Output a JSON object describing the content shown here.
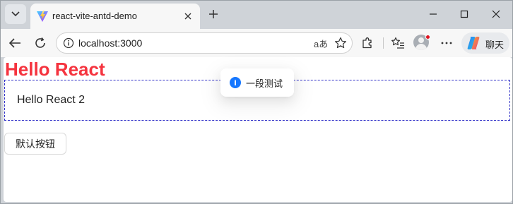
{
  "browser": {
    "tab": {
      "title": "react-vite-antd-demo"
    },
    "window_controls": [
      "minimize",
      "maximize",
      "close"
    ],
    "address_bar": {
      "url": "localhost:3000",
      "read_aloud_label": "aあ"
    },
    "copilot": {
      "label": "聊天"
    }
  },
  "page": {
    "heading": "Hello React",
    "box_text": "Hello React 2",
    "button_label": "默认按钮",
    "message": {
      "icon": "i",
      "text": "一段测试"
    }
  },
  "colors": {
    "heading": "#f5343f",
    "info_icon": "#1677ff",
    "dashed_border": "#3030c8"
  }
}
